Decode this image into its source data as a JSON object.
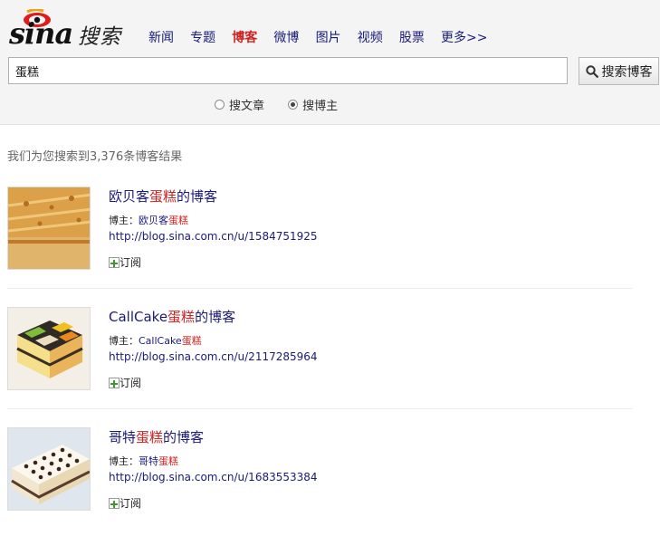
{
  "brand": {
    "logo_text": "sina",
    "search_word": "搜索"
  },
  "nav": [
    {
      "label": "新闻",
      "active": false
    },
    {
      "label": "专题",
      "active": false
    },
    {
      "label": "博客",
      "active": true
    },
    {
      "label": "微博",
      "active": false
    },
    {
      "label": "图片",
      "active": false
    },
    {
      "label": "视频",
      "active": false
    },
    {
      "label": "股票",
      "active": false
    },
    {
      "label": "更多>>",
      "active": false
    }
  ],
  "search": {
    "value": "蛋糕",
    "button_label": "搜索博客"
  },
  "search_mode": {
    "options": [
      {
        "label": "搜文章",
        "selected": false
      },
      {
        "label": "搜博主",
        "selected": true
      }
    ]
  },
  "summary": "我们为您搜索到3,376条博客结果",
  "keyword": "蛋糕",
  "results": [
    {
      "title_pre": "欧贝客",
      "title_kw": "蛋糕",
      "title_post": "的博客",
      "owner_label": "博主：",
      "owner_pre": "欧贝客",
      "owner_kw": "蛋糕",
      "url": "http://blog.sina.com.cn/u/1584751925",
      "subscribe": "订阅",
      "thumb": "cake-slice"
    },
    {
      "title_pre": "CallCake",
      "title_kw": "蛋糕",
      "title_post": "的博客",
      "owner_label": "博主：",
      "owner_pre": "CallCake",
      "owner_kw": "蛋糕",
      "url": "http://blog.sina.com.cn/u/2117285964",
      "subscribe": "订阅",
      "thumb": "cake-squares"
    },
    {
      "title_pre": "哥特",
      "title_kw": "蛋糕",
      "title_post": "的博客",
      "owner_label": "博主：",
      "owner_pre": "哥特",
      "owner_kw": "蛋糕",
      "url": "http://blog.sina.com.cn/u/1683553384",
      "subscribe": "订阅",
      "thumb": "cake-dots"
    }
  ],
  "colors": {
    "link": "#1a1a7a",
    "highlight": "#cc2222",
    "header_bg": "#f4f4f4"
  }
}
